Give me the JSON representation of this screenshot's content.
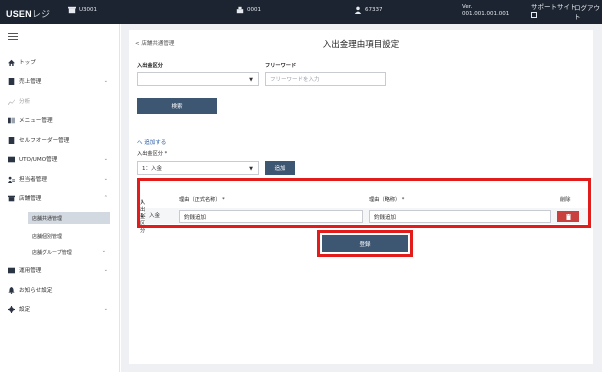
{
  "topbar": {
    "logo_bold": "USEN",
    "logo_light": "レジ",
    "store_code": "U3001",
    "terminal": "0001",
    "user": "67337",
    "version_label": "Ver.",
    "version": "001.001.001.001",
    "support": "サポートサイト",
    "logout": "ログアウト"
  },
  "sidebar": {
    "items": [
      {
        "label": "トップ",
        "icon": "home-icon"
      },
      {
        "label": "売上管理",
        "icon": "sales-icon",
        "chevron": "⌄"
      },
      {
        "label": "分析",
        "icon": "analysis-icon"
      },
      {
        "label": "メニュー管理",
        "icon": "menu-icon"
      },
      {
        "label": "セルフオーダー管理",
        "icon": "self-order-icon"
      },
      {
        "label": "UTO/UMO管理",
        "icon": "uto-icon",
        "chevron": "⌄"
      },
      {
        "label": "担当者管理",
        "icon": "staff-icon",
        "chevron": "⌄"
      },
      {
        "label": "店舗管理",
        "icon": "store-icon",
        "chevron": "⌃"
      },
      {
        "label": "運用管理",
        "icon": "operation-icon",
        "chevron": "⌄"
      },
      {
        "label": "お知らせ設定",
        "icon": "notice-icon"
      },
      {
        "label": "設定",
        "icon": "settings-icon",
        "chevron": "⌄"
      }
    ],
    "subitems": [
      {
        "label": "店舗共通管理"
      },
      {
        "label": "店舗個別管理"
      },
      {
        "label": "店舗グループ管理",
        "chevron": "⌄"
      }
    ]
  },
  "main": {
    "breadcrumb": "< 店舗共通管理",
    "title": "入出金理由項目設定",
    "filter": {
      "type_label": "入出金区分",
      "keyword_label": "フリーワード",
      "keyword_placeholder": "フリーワードを入力",
      "search_button": "検索"
    },
    "add": {
      "toggle": "へ 追加する",
      "type_label": "入出金区分 *",
      "type_value": "1：入金",
      "add_button": "追加"
    },
    "table": {
      "headers": {
        "type": "入出金区分",
        "reason_formal": "理由（正式名称） *",
        "reason_short": "理由（略称） *",
        "delete": "削除"
      },
      "rows": [
        {
          "type": "1：入金",
          "reason_formal": "釣銭追加",
          "reason_short": "釣銭追加"
        }
      ],
      "register_button": "登録"
    }
  },
  "colors": {
    "topbar": "#1c2431",
    "primary_button": "#3d5672",
    "highlight": "#e21b1b",
    "delete": "#c8413f"
  }
}
